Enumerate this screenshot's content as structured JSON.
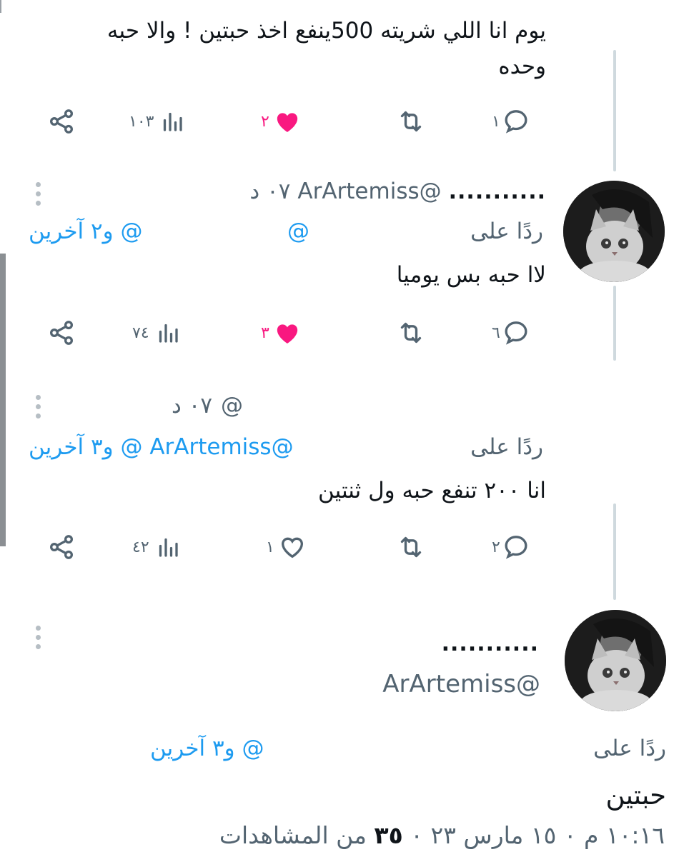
{
  "tweets": [
    {
      "text_line1": "يوم انا اللي شريته 500ينفع اخذ حبتين ! والا حبه",
      "text_line2": "وحده",
      "actions": {
        "replies": "١",
        "likes": "٢",
        "views": "١٠٣"
      }
    },
    {
      "name": "...........",
      "handle": "@ArArtemiss",
      "time": "٠٧ د",
      "replying_to_label": "ردًا على",
      "replying_to_handles": "@",
      "replying_to_others": "@ و٢ آخرين",
      "text": "لاا حبه بس يوميا",
      "actions": {
        "replies": "٦",
        "likes": "٣",
        "views": "٧٤"
      }
    },
    {
      "handle": "@",
      "time": "٠٧ د",
      "replying_to_label": "ردًا على",
      "replying_to_others": "@ArArtemiss @ و٣ آخرين",
      "text": "انا ٢٠٠ تنفع حبه ول ثنتين",
      "actions": {
        "replies": "٢",
        "likes": "١",
        "views": "٤٢"
      }
    },
    {
      "name": "...........",
      "handle": "@ArArtemiss",
      "replying_to_label": "ردًا على",
      "replying_to_others": "@ و٣ آخرين",
      "text": "حبتين",
      "footer_time": "١٠:١٦ م ٠ ١٥ مارس ٢٣ ٠",
      "footer_views_count": "٣٥",
      "footer_views_label": "من المشاهدات"
    }
  ],
  "colors": {
    "like_active": "#f91880",
    "link": "#1d9bf0",
    "muted": "#536471",
    "thread_line": "#cfd9de"
  },
  "icons": [
    "reply-icon",
    "retweet-icon",
    "like-icon",
    "views-icon",
    "share-icon",
    "more-icon",
    "avatar-cat-photo"
  ]
}
